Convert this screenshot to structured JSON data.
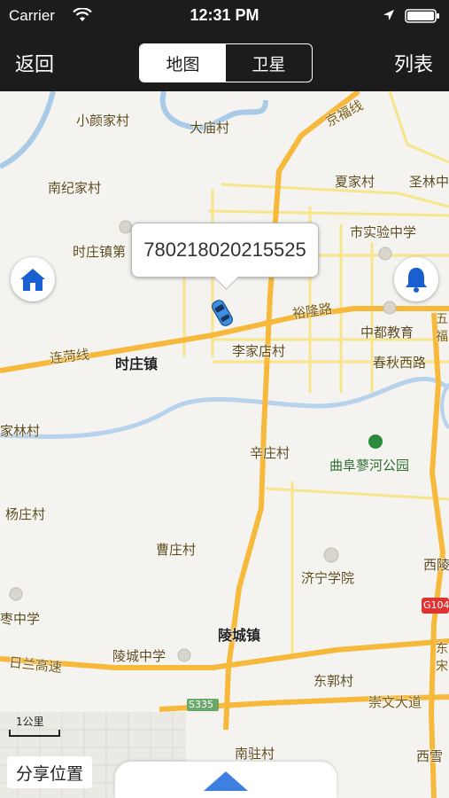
{
  "status_bar": {
    "carrier": "Carrier",
    "time": "12:31 PM",
    "wifi_icon": "wifi-icon",
    "location_icon": "location-arrow-icon",
    "battery_icon": "battery-icon"
  },
  "nav_bar": {
    "back_label": "返回",
    "list_label": "列表",
    "segments": [
      {
        "label": "地图",
        "selected": true
      },
      {
        "label": "卫星",
        "selected": false
      }
    ]
  },
  "map": {
    "callout_text": "780218020215525",
    "home_icon": "home-icon",
    "bell_icon": "bell-icon",
    "vehicle_icon": "car-icon",
    "scale_label": "1公里",
    "share_label": "分享位置",
    "expand_icon": "arrow-up-icon",
    "colors": {
      "road_major": "#f6b93b",
      "road_minor": "#f7e58b",
      "water": "#a9cbe8",
      "accent": "#1a5fd1"
    },
    "labels": {
      "xiaoyan": "小颜家村",
      "damiao": "大庙村",
      "jingfu": "京福线",
      "nanji": "南纪家村",
      "xiajia": "夏家村",
      "shenglin": "圣林中",
      "shizhuang_ding": "时庄镇第",
      "shishiyan": "市实验中学",
      "yulong": "裕隆路",
      "zhongdu": "中都教育",
      "wufu": "五福",
      "lianhe": "连菏线",
      "shizhuang": "时庄镇",
      "lijiadian": "李家店村",
      "chunqiu": "春秋西路",
      "jialin": "家林村",
      "xinzhuang": "辛庄村",
      "qufu_park": "曲阜蓼河公园",
      "yangzhuang": "杨庄村",
      "caozhuang": "曹庄村",
      "xiling": "西陵",
      "jining": "济宁学院",
      "g104": "G104",
      "zaozhong": "枣中学",
      "lingcheng_town": "陵城镇",
      "lingcheng_school": "陵城中学",
      "rilan": "日兰高速",
      "dongguo": "东郭村",
      "dongsong": "东宋",
      "s335": "S335",
      "chongwen": "崇文大道",
      "nanzhu": "南驻村",
      "xixue": "西雪"
    }
  }
}
